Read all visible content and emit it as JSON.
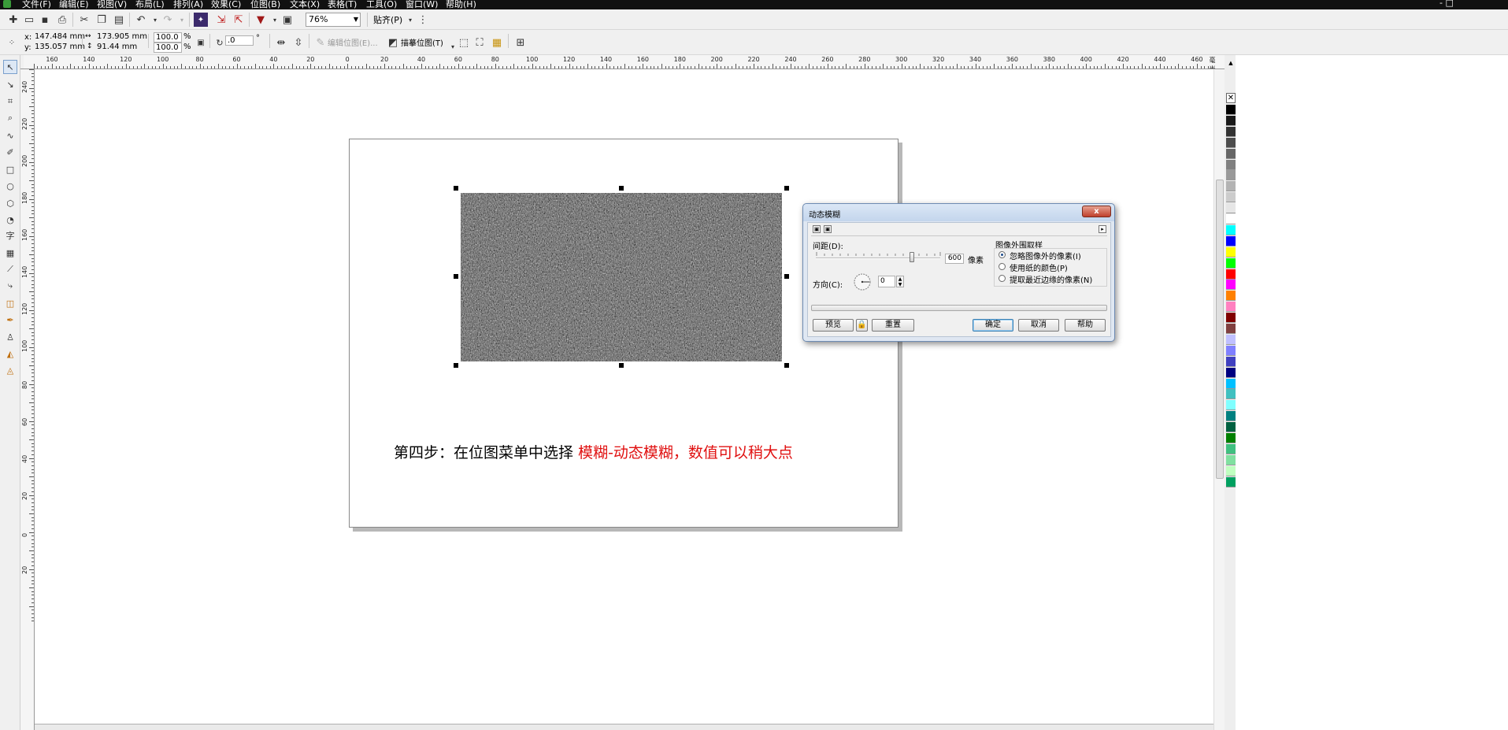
{
  "menubar": {
    "items": [
      "文件(F)",
      "编辑(E)",
      "视图(V)",
      "布局(L)",
      "排列(A)",
      "效果(C)",
      "位图(B)",
      "文本(X)",
      "表格(T)",
      "工具(O)",
      "窗口(W)",
      "帮助(H)"
    ],
    "window_controls": "- □"
  },
  "toolbar1": {
    "zoom": "76%",
    "snap_label": "贴齐(P)"
  },
  "property_bar": {
    "x_label": "x:",
    "x_value": "147.484 mm",
    "y_label": "y:",
    "y_value": "135.057 mm",
    "width_value": "173.905 mm",
    "height_value": "91.44 mm",
    "scale_x": "100.0",
    "scale_y": "100.0",
    "percent": "%",
    "rotation_value": ".0",
    "degree": "°",
    "edit_bitmap_label": "编辑位图(E)...",
    "trace_bitmap_label": "描摹位图(T)"
  },
  "ruler_top": {
    "labels": [
      "160",
      "140",
      "120",
      "100",
      "80",
      "60",
      "40",
      "20",
      "0",
      "20",
      "40",
      "60",
      "80",
      "100",
      "120",
      "140",
      "160",
      "180",
      "200",
      "220",
      "240",
      "260",
      "280",
      "300",
      "320",
      "340",
      "360",
      "380",
      "400",
      "420",
      "440",
      "460"
    ],
    "unit": "毫米"
  },
  "ruler_left": {
    "labels": [
      "240",
      "220",
      "200",
      "180",
      "160",
      "140",
      "120",
      "100",
      "80",
      "60",
      "40",
      "20",
      "0",
      "20"
    ]
  },
  "toolbox": {
    "text_tool": "字"
  },
  "caption": {
    "black": "第四步：在位图菜单中选择",
    "red": "模糊-动态模糊，数值可以稍大点"
  },
  "dialog": {
    "title": "动态模糊",
    "close": "x",
    "distance_label": "间距(D):",
    "distance_value": "600",
    "distance_unit": "像素",
    "direction_label": "方向(C):",
    "direction_value": "0",
    "sampling_group": "图像外围取样",
    "options": [
      "忽略图像外的像素(I)",
      "使用纸的颜色(P)",
      "提取最近边缘的像素(N)"
    ],
    "selected_option": 0,
    "preview_button": "预览",
    "reset_button": "重置",
    "ok_button": "确定",
    "cancel_button": "取消",
    "help_button": "帮助"
  },
  "palette": {
    "colors": [
      "#000000",
      "#1a1a1a",
      "#333333",
      "#4d4d4d",
      "#666666",
      "#808080",
      "#999999",
      "#b3b3b3",
      "#cccccc",
      "#e6e6e6",
      "#ffffff",
      "#00ffff",
      "#0000ff",
      "#ffff00",
      "#00ff00",
      "#ff0000",
      "#ff00ff",
      "#ff8000",
      "#ff80c0",
      "#800000",
      "#804040",
      "#c0c0ff",
      "#8080ff",
      "#4040c0",
      "#000080",
      "#00c0ff",
      "#40c0c0",
      "#80ffff",
      "#008080",
      "#006040",
      "#008000",
      "#40c080",
      "#80e0a0",
      "#c0ffc0",
      "#00a060"
    ]
  }
}
